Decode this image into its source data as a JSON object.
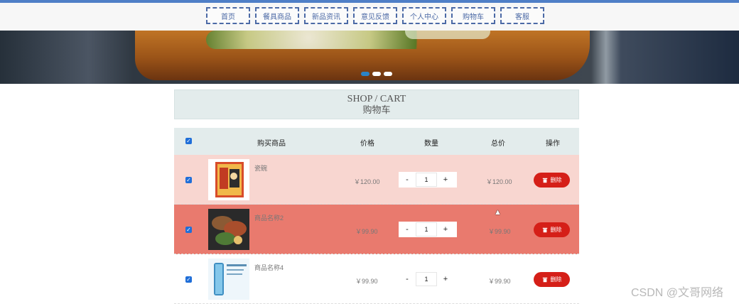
{
  "nav": [
    "首页",
    "餐具商品",
    "新品资讯",
    "意见反馈",
    "个人中心",
    "购物车",
    "客服"
  ],
  "banner": {
    "dots": 3,
    "active_dot": 1
  },
  "cart": {
    "title_en": "SHOP / CART",
    "title_cn": "购物车"
  },
  "table": {
    "headers": [
      "购买商品",
      "价格",
      "数量",
      "总价",
      "操作"
    ],
    "rows": [
      {
        "name": "瓷碗",
        "price": "￥120.00",
        "qty": "1",
        "total": "￥120.00",
        "delete": "删除",
        "checked": true,
        "bg": "#f8d6d0",
        "img": "book"
      },
      {
        "name": "商品名称2",
        "price": "￥99.90",
        "qty": "1",
        "total": "￥99.90",
        "delete": "删除",
        "checked": true,
        "bg": "#e97a6e",
        "img": "food"
      },
      {
        "name": "商品名称4",
        "price": "￥99.90",
        "qty": "1",
        "total": "￥99.90",
        "delete": "删除",
        "checked": true,
        "bg": "#ffffff",
        "img": "bottle"
      }
    ]
  },
  "qty_controls": {
    "minus": "-",
    "plus": "+"
  },
  "icons": {
    "checkbox": "check-icon",
    "delete": "trash-icon",
    "cursor": "mouse-pointer-icon"
  },
  "watermark": "CSDN @文哥网络"
}
